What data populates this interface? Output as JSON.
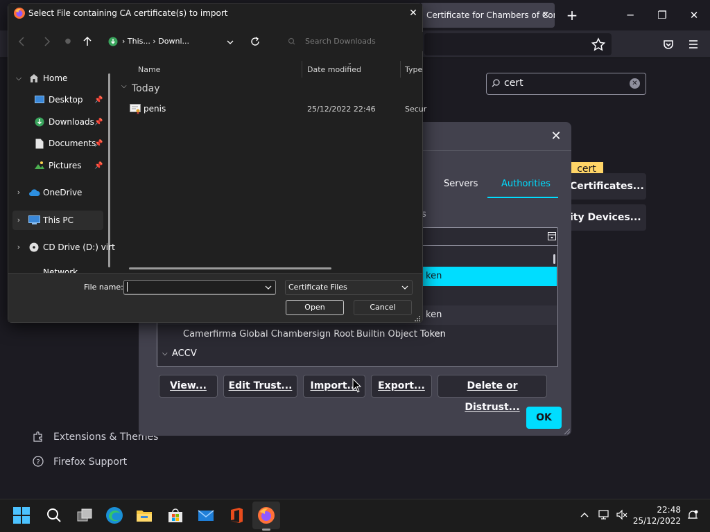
{
  "firefox": {
    "tab_title": "Certificate for Chambers of Cor",
    "tab_close": "×",
    "new_tab": "+",
    "window_controls": {
      "minimize": "─",
      "maximize": "❐",
      "close": "✕"
    }
  },
  "settings": {
    "search_value": "cert",
    "search_highlight": "cert",
    "certificates_button": "Certificates...",
    "security_devices_button": "ity Devices...",
    "footer": {
      "extensions": "Extensions & Themes",
      "support": "Firefox Support"
    }
  },
  "cert_manager": {
    "close": "✕",
    "tabs": {
      "servers": "Servers",
      "authorities": "Authorities"
    },
    "partial_label": "s",
    "rows": [
      {
        "name": "",
        "token": "ken",
        "selected": true
      },
      {
        "name": "",
        "token": "",
        "selected": false
      },
      {
        "name": "",
        "token": "ken",
        "selected": false
      },
      {
        "name": "Camerfirma Global Chambersign Root",
        "token": "Builtin Object Token",
        "selected": false
      },
      {
        "name": "ACCV",
        "token": "",
        "group": true
      }
    ],
    "buttons": {
      "view": "View...",
      "edit_trust": "Edit Trust...",
      "import": "Import...",
      "export": "Export...",
      "delete": "Delete or Distrust...",
      "ok": "OK"
    }
  },
  "file_dialog": {
    "title": "Select File containing CA certificate(s) to import",
    "close": "✕",
    "breadcrumb": [
      "This...",
      "Downl..."
    ],
    "search_placeholder": "Search Downloads",
    "sidebar": {
      "home": "Home",
      "desktop": "Desktop",
      "downloads": "Downloads",
      "documents": "Documents",
      "pictures": "Pictures",
      "onedrive": "OneDrive",
      "this_pc": "This PC",
      "cd_drive": "CD Drive (D:) virt",
      "network": "Network"
    },
    "columns": {
      "name": "Name",
      "date_modified": "Date modified",
      "type": "Type"
    },
    "group_label": "Today",
    "files": [
      {
        "name": "penis",
        "date": "25/12/2022 22:46",
        "type": "Secur"
      }
    ],
    "file_name_label": "File name:",
    "file_name_value": "",
    "file_type": "Certificate Files",
    "open_button": "Open",
    "cancel_button": "Cancel"
  },
  "taskbar": {
    "time": "22:48",
    "date": "25/12/2022"
  },
  "colors": {
    "accent": "#00ddff",
    "highlight": "#ffd567",
    "dialog_bg": "#42414d"
  }
}
